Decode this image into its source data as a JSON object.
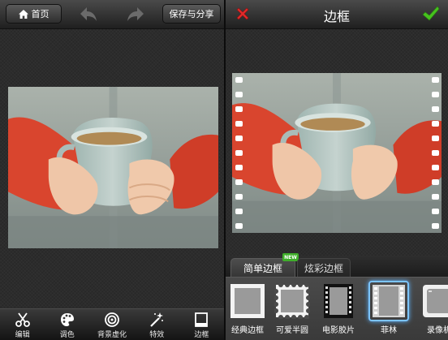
{
  "left": {
    "home_label": "首页",
    "save_label": "保存与分享",
    "toolbar": [
      {
        "label": "编辑",
        "icon": "scissors-icon"
      },
      {
        "label": "调色",
        "icon": "palette-icon"
      },
      {
        "label": "背景虚化",
        "icon": "blur-target-icon"
      },
      {
        "label": "特效",
        "icon": "magic-wand-icon"
      },
      {
        "label": "边框",
        "icon": "frame-icon"
      }
    ]
  },
  "right": {
    "title": "边框",
    "tabs": [
      {
        "label": "简单边框",
        "badge": "NEW"
      },
      {
        "label": "炫彩边框"
      }
    ],
    "frames": [
      {
        "label": "经典边框"
      },
      {
        "label": "可爱半圆"
      },
      {
        "label": "电影胶片"
      },
      {
        "label": "菲林"
      },
      {
        "label": "录像机"
      }
    ],
    "selected_frame": "菲林"
  },
  "colors": {
    "cancel": "#e02a2a",
    "confirm": "#46c21e",
    "badge": "#3fae2a",
    "selection": "#7cc4ff"
  }
}
